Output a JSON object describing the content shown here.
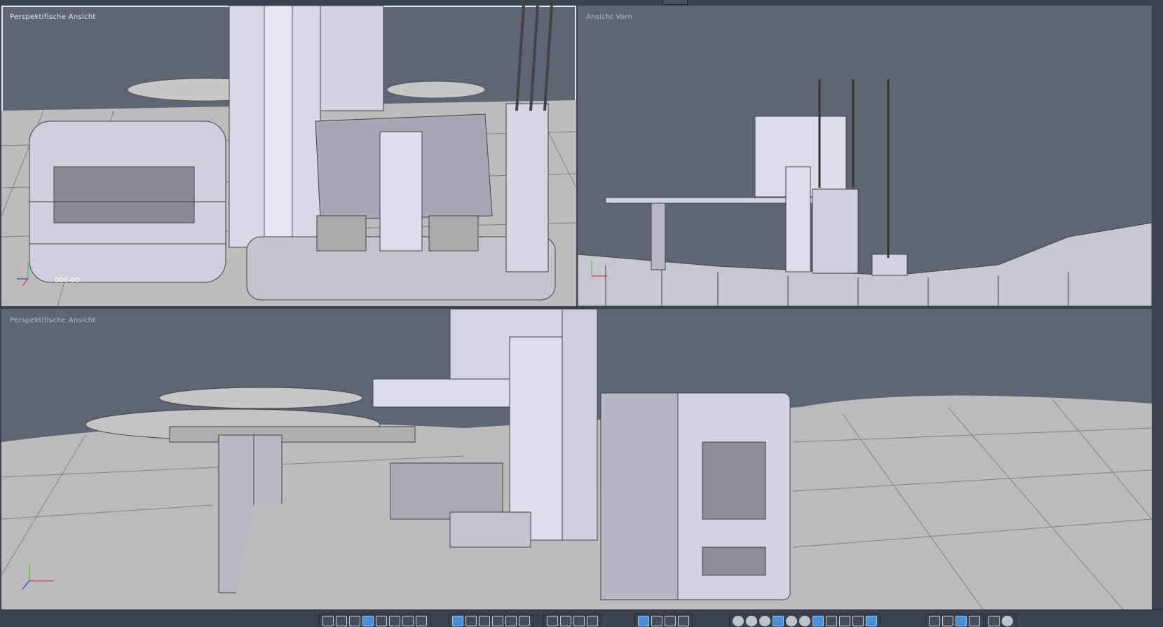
{
  "viewports": {
    "top_left": {
      "label": "Perspektifische Ansicht",
      "coord_readout": "000-00",
      "active": true
    },
    "top_right": {
      "label": "Ansicht Vorn"
    },
    "bottom": {
      "label": "Perspektifische Ansicht"
    }
  },
  "axes": {
    "x": "x",
    "y": "y",
    "z": "z"
  },
  "toolbar": {
    "groups": [
      {
        "name": "layout",
        "buttons": [
          "single",
          "split-v",
          "split-h",
          "quad-active",
          "split-3a",
          "split-3b",
          "split-3c",
          "split-3d"
        ]
      },
      {
        "name": "tools",
        "buttons": [
          "select",
          "move",
          "rotate",
          "scale",
          "grid",
          "frame"
        ]
      },
      {
        "name": "camera",
        "buttons": [
          "fit",
          "orbit",
          "pan",
          "zoom"
        ]
      },
      {
        "name": "edit",
        "buttons": [
          "pointer",
          "move",
          "rotate",
          "scale"
        ]
      },
      {
        "name": "shading",
        "buttons": [
          "wire",
          "wire2",
          "solid",
          "textured",
          "smooth",
          "flat",
          "pointer",
          "check",
          "light",
          "figure",
          "group"
        ]
      },
      {
        "name": "view",
        "buttons": [
          "back",
          "frame",
          "quad-active",
          "side"
        ]
      },
      {
        "name": "misc",
        "buttons": [
          "split",
          "sphere"
        ]
      }
    ]
  },
  "colors": {
    "viewport_bg": "#5f6575",
    "model": "#d4d3e3",
    "ground": "#bdbbbb",
    "active_border": "#e8e8ee",
    "accent": "#4a8ed8"
  }
}
